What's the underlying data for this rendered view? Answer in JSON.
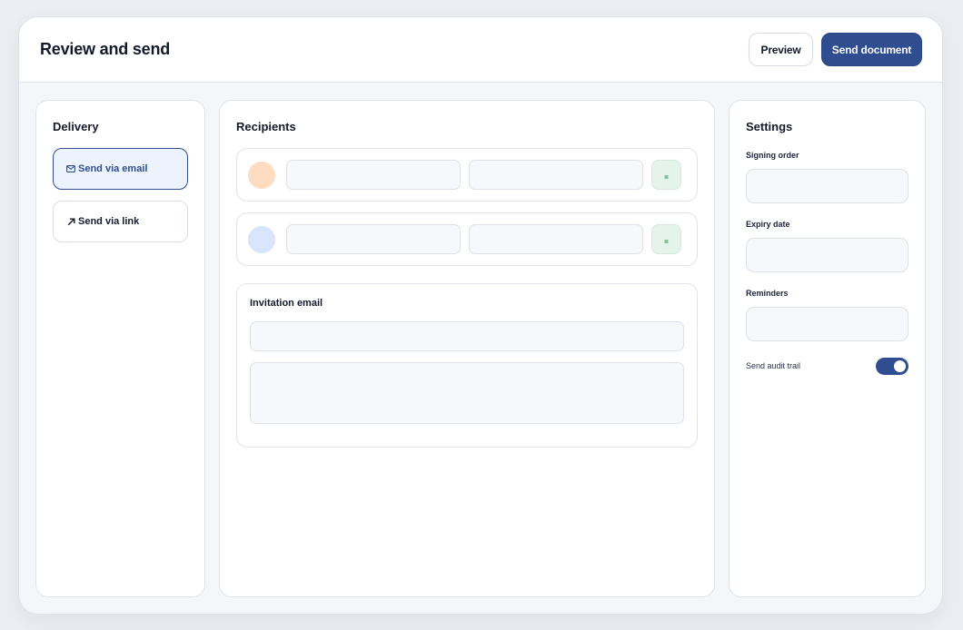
{
  "header": {
    "title": "Review and send",
    "preview_label": "Preview",
    "send_label": "Send document"
  },
  "delivery": {
    "title": "Delivery",
    "options": [
      {
        "label": "Send via email",
        "icon": "mail-icon",
        "selected": true
      },
      {
        "label": "Send via link",
        "icon": "arrow-up-right-icon",
        "selected": false
      }
    ]
  },
  "recipients": {
    "title": "Recipients",
    "rows": [
      {
        "avatar_color": "#fddcc2",
        "role_icon": "signer-icon"
      },
      {
        "avatar_color": "#d9e4fd",
        "role_icon": "signer-icon"
      }
    ],
    "invitation": {
      "title": "Invitation email"
    }
  },
  "settings": {
    "title": "Settings",
    "signing_order_label": "Signing order",
    "expiry_label": "Expiry date",
    "reminders_label": "Reminders",
    "audit_trail_label": "Send audit trail",
    "audit_trail_on": true
  },
  "colors": {
    "accent": "#2f4d8f",
    "accent_light": "#edf3fc",
    "success_bg": "#e4f4ea",
    "success_fg": "#2e8a52"
  }
}
